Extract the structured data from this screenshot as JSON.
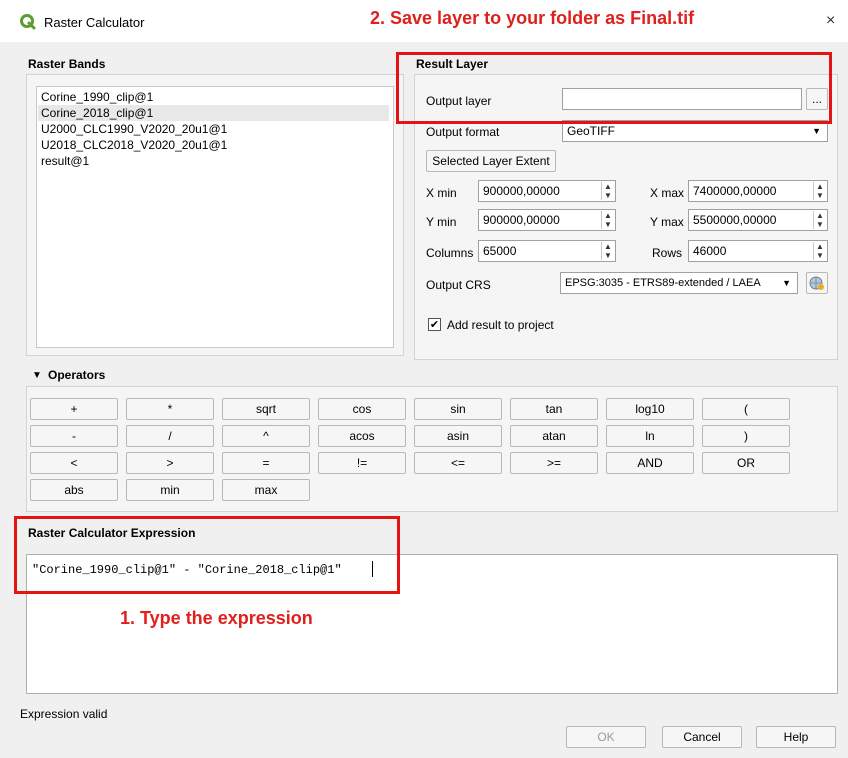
{
  "window": {
    "title": "Raster Calculator",
    "close_glyph": "×"
  },
  "annotations": {
    "save_note": "2. Save layer to your folder as Final.tif",
    "type_note": "1. Type the expression",
    "color": "#e41414"
  },
  "raster_bands": {
    "title": "Raster Bands",
    "items": [
      "Corine_1990_clip@1",
      "Corine_2018_clip@1",
      "U2000_CLC1990_V2020_20u1@1",
      "U2018_CLC2018_V2020_20u1@1",
      "result@1"
    ],
    "selected_index": 1
  },
  "result_layer": {
    "title": "Result Layer",
    "output_layer_label": "Output layer",
    "output_layer_value": "",
    "browse_label": "...",
    "output_format_label": "Output format",
    "output_format_value": "GeoTIFF",
    "selected_extent_button": "Selected Layer Extent",
    "xmin_label": "X min",
    "xmin_value": "900000,00000",
    "xmax_label": "X max",
    "xmax_value": "7400000,00000",
    "ymin_label": "Y min",
    "ymin_value": "900000,00000",
    "ymax_label": "Y max",
    "ymax_value": "5500000,00000",
    "columns_label": "Columns",
    "columns_value": "65000",
    "rows_label": "Rows",
    "rows_value": "46000",
    "crs_label": "Output CRS",
    "crs_value": "EPSG:3035 - ETRS89-extended / LAEA",
    "add_result_label": "Add result to project",
    "add_result_checked": true
  },
  "operators": {
    "title": "Operators",
    "rows": [
      [
        "+",
        "*",
        "sqrt",
        "cos",
        "sin",
        "tan",
        "log10",
        "("
      ],
      [
        "-",
        "/",
        "^",
        "acos",
        "asin",
        "atan",
        "ln",
        ")"
      ],
      [
        "<",
        ">",
        "=",
        "!=",
        "<=",
        ">=",
        "AND",
        "OR"
      ],
      [
        "abs",
        "min",
        "max"
      ]
    ]
  },
  "expression": {
    "title": "Raster Calculator Expression",
    "value": "\"Corine_1990_clip@1\" - \"Corine_2018_clip@1\"",
    "status": "Expression valid"
  },
  "buttons": {
    "ok": "OK",
    "cancel": "Cancel",
    "help": "Help"
  },
  "icons": {
    "app": "qgis-logo-icon",
    "crs": "globe-crs-icon"
  },
  "colors": {
    "qgis_green": "#5b9e2d",
    "accent_red": "#e41414"
  }
}
